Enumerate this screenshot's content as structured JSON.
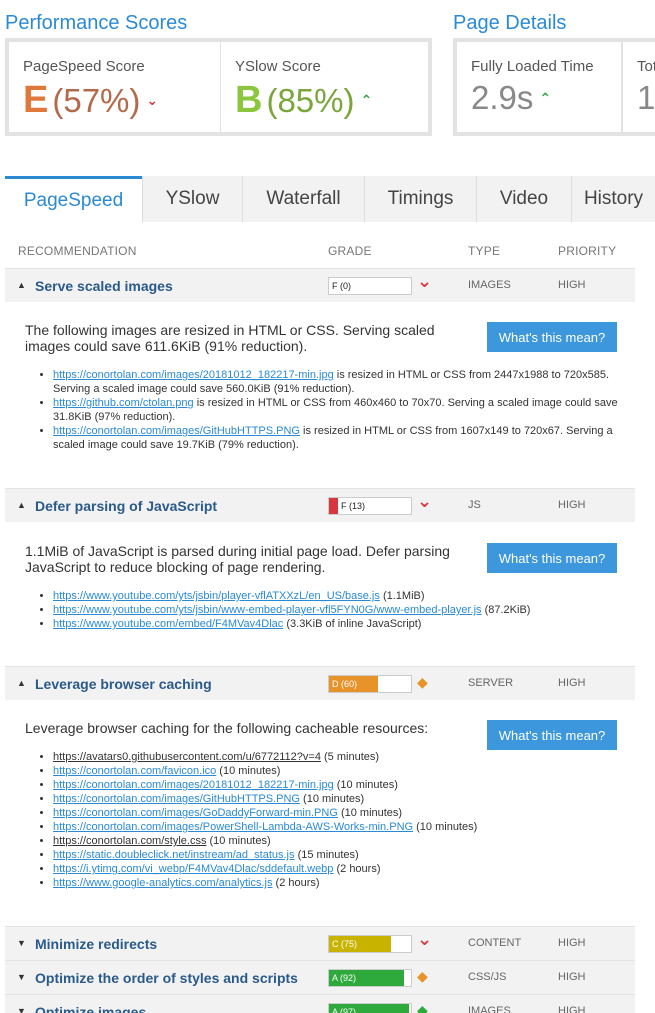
{
  "performance": {
    "title": "Performance Scores",
    "pagespeed": {
      "label": "PageSpeed Score",
      "grade": "E",
      "percent": "(57%)",
      "trend": "down",
      "color": "#e0783c"
    },
    "yslow": {
      "label": "YSlow Score",
      "grade": "B",
      "percent": "(85%)",
      "trend": "up",
      "color": "#8cc63f"
    }
  },
  "details": {
    "title": "Page Details",
    "loaded": {
      "label": "Fully Loaded Time",
      "value": "2.9s"
    },
    "total": {
      "label": "Tot",
      "value": "1."
    }
  },
  "tabs": [
    "PageSpeed",
    "YSlow",
    "Waterfall",
    "Timings",
    "Video",
    "History"
  ],
  "table_headers": {
    "rec": "RECOMMENDATION",
    "grade": "GRADE",
    "type": "TYPE",
    "priority": "PRIORITY"
  },
  "button_label": "What's this mean?",
  "recs": [
    {
      "name": "Serve scaled images",
      "grade": "F (0)",
      "fill_pct": 0,
      "fill_color": "#d9363e",
      "icon": "chevron-down",
      "type": "IMAGES",
      "priority": "HIGH",
      "desc": "The following images are resized in HTML or CSS. Serving scaled images could save 611.6KiB (91% reduction).",
      "items": [
        {
          "link": "https://conortolan.com/images/20181012_182217-min.jpg",
          "rest": " is resized in HTML or CSS from 2447x1988 to 720x585. Serving a scaled image could save 560.0KiB (91% reduction)."
        },
        {
          "link": "https://github.com/ctolan.png",
          "rest": " is resized in HTML or CSS from 460x460 to 70x70. Serving a scaled image could save 31.8KiB (97% reduction)."
        },
        {
          "link": "https://conortolan.com/images/GitHubHTTPS.PNG",
          "rest": " is resized in HTML or CSS from 1607x149 to 720x67. Serving a scaled image could save 19.7KiB (79% reduction)."
        }
      ]
    },
    {
      "name": "Defer parsing of JavaScript",
      "grade": "F (13)",
      "fill_pct": 13,
      "fill_color": "#d9363e",
      "icon": "chevron-down",
      "type": "JS",
      "priority": "HIGH",
      "desc": "1.1MiB of JavaScript is parsed during initial page load. Defer parsing JavaScript to reduce blocking of page rendering.",
      "items": [
        {
          "link": "https://www.youtube.com/yts/jsbin/player-vflATXXzL/en_US/base.js",
          "rest": " (1.1MiB)"
        },
        {
          "link": "https://www.youtube.com/yts/jsbin/www-embed-player-vfl5FYN0G/www-embed-player.js",
          "rest": " (87.2KiB)"
        },
        {
          "link": "https://www.youtube.com/embed/F4MVav4Dlac",
          "rest": " (3.3KiB of inline JavaScript)"
        }
      ]
    },
    {
      "name": "Leverage browser caching",
      "grade": "D (60)",
      "fill_pct": 60,
      "fill_color": "#e8932a",
      "icon": "diamond",
      "type": "SERVER",
      "priority": "HIGH",
      "desc": "Leverage browser caching for the following cacheable resources:",
      "items": [
        {
          "link": "https://avatars0.githubusercontent.com/u/6772112?v=4",
          "rest": " (5 minutes)",
          "dark": true
        },
        {
          "link": "https://conortolan.com/favicon.ico",
          "rest": " (10 minutes)"
        },
        {
          "link": "https://conortolan.com/images/20181012_182217-min.jpg",
          "rest": " (10 minutes)"
        },
        {
          "link": "https://conortolan.com/images/GitHubHTTPS.PNG",
          "rest": " (10 minutes)"
        },
        {
          "link": "https://conortolan.com/images/GoDaddyForward-min.PNG",
          "rest": " (10 minutes)"
        },
        {
          "link": "https://conortolan.com/images/PowerShell-Lambda-AWS-Works-min.PNG",
          "rest": " (10 minutes)"
        },
        {
          "link": "https://conortolan.com/style.css",
          "rest": " (10 minutes)",
          "dark": true
        },
        {
          "link": "https://static.doubleclick.net/instream/ad_status.js",
          "rest": " (15 minutes)"
        },
        {
          "link": "https://i.ytimg.com/vi_webp/F4MVav4Dlac/sddefault.webp",
          "rest": " (2 hours)"
        },
        {
          "link": "https://www.google-analytics.com/analytics.js",
          "rest": " (2 hours)"
        }
      ]
    },
    {
      "name": "Minimize redirects",
      "grade": "C (75)",
      "fill_pct": 75,
      "fill_color": "#c8b400",
      "icon": "chevron-down",
      "type": "CONTENT",
      "priority": "HIGH"
    },
    {
      "name": "Optimize the order of styles and scripts",
      "grade": "A (92)",
      "fill_pct": 92,
      "fill_color": "#2eaa3c",
      "icon": "diamond",
      "type": "CSS/JS",
      "priority": "HIGH"
    },
    {
      "name": "Optimize images",
      "grade": "A (97)",
      "fill_pct": 97,
      "fill_color": "#2eaa3c",
      "icon": "diamond-green",
      "type": "IMAGES",
      "priority": "HIGH"
    }
  ]
}
